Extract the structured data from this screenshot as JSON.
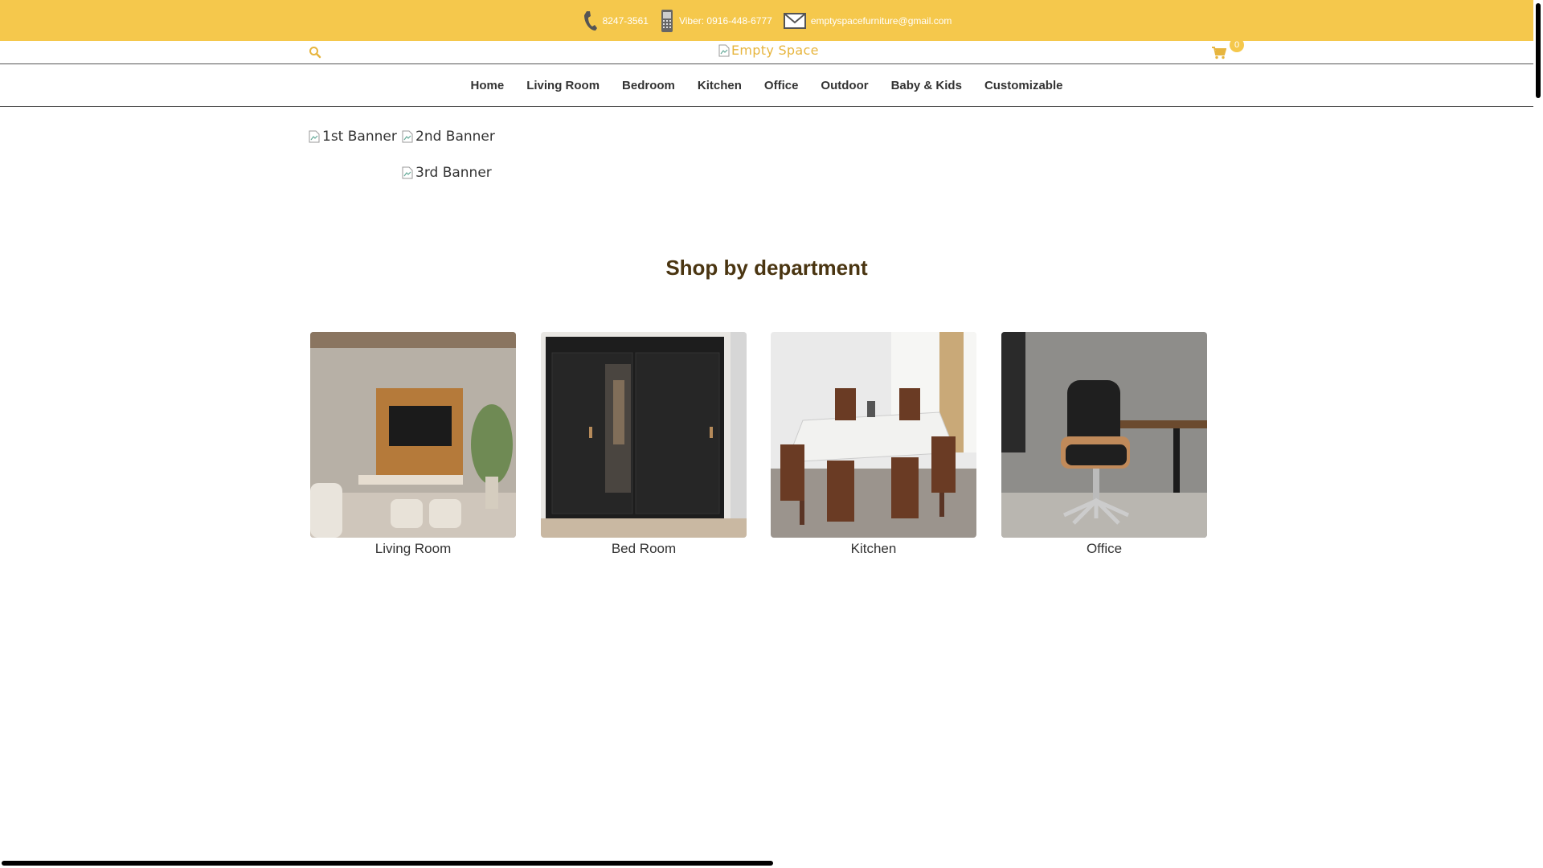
{
  "topbar": {
    "phone": "8247-3561",
    "viber": "Viber: 0916-448-6777",
    "email": "emptyspacefurniture@gmail.com",
    "color": "#f5c84c"
  },
  "header": {
    "logo_alt": "Empty Space",
    "cart_count": "0",
    "accent": "#e7b53e"
  },
  "nav": {
    "items": [
      "Home",
      "Living Room",
      "Bedroom",
      "Kitchen",
      "Office",
      "Outdoor",
      "Baby & Kids",
      "Customizable"
    ]
  },
  "banners": [
    "1st Banner",
    "2nd Banner",
    "3rd Banner"
  ],
  "section": {
    "title": "Shop by department"
  },
  "departments": [
    {
      "label": "Living Room",
      "icon": "living-room-photo"
    },
    {
      "label": "Bed Room",
      "icon": "bedroom-wardrobe-photo"
    },
    {
      "label": "Kitchen",
      "icon": "dining-set-photo"
    },
    {
      "label": "Office",
      "icon": "office-chair-photo"
    }
  ]
}
